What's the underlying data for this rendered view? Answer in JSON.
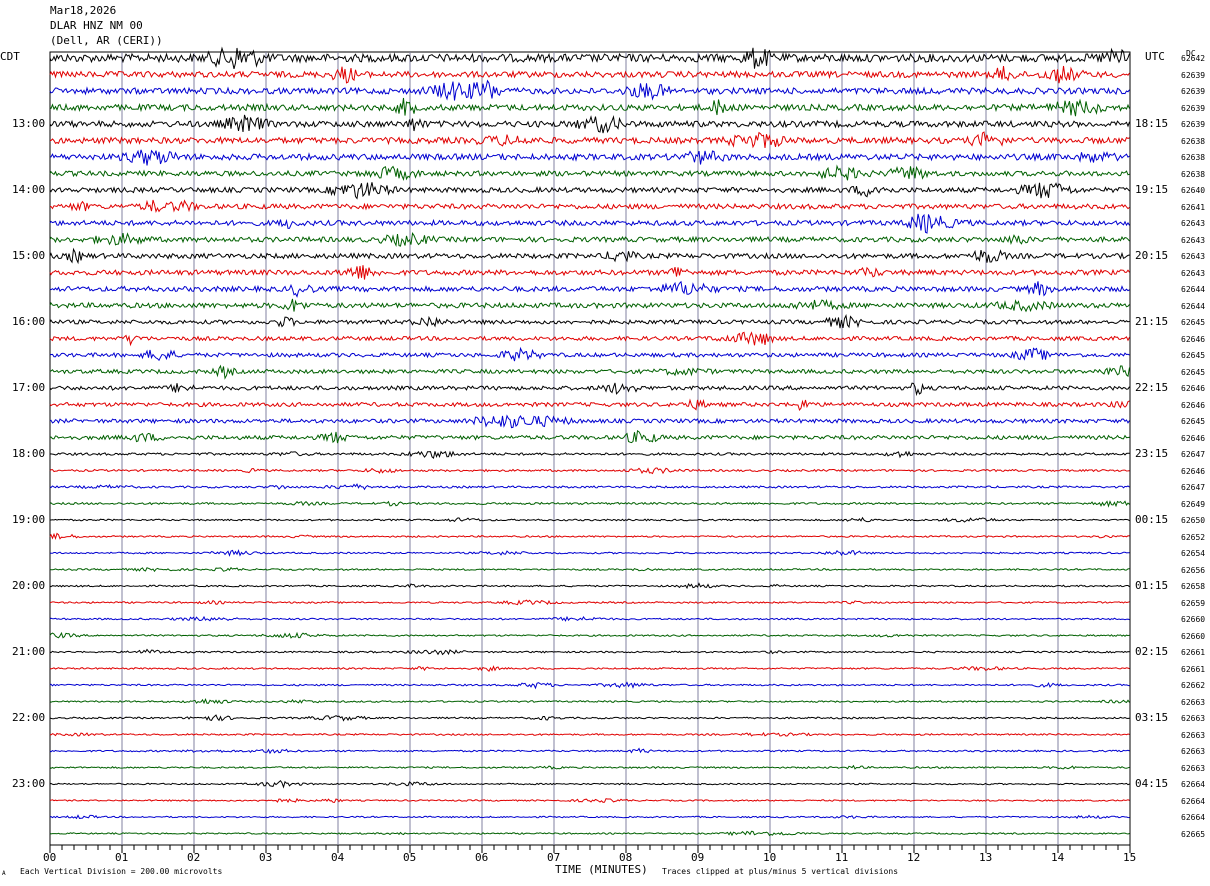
{
  "header": {
    "date": "Mar18,2026",
    "station": "DLAR HNZ NM 00",
    "location": "(Dell, AR (CERI))"
  },
  "left_zone": "CDT",
  "right_zone": "UTC",
  "dc_header": "DC",
  "footer": {
    "scale_note": "Each Vertical Division =  200.00 microvolts",
    "clip_note": "Traces clipped at plus/minus 5 vertical divisions",
    "corner_mark": "A"
  },
  "colors": {
    "black": "#000000",
    "red": "#e00000",
    "blue": "#0000d0",
    "green": "#006000",
    "grid": "#8080a0"
  },
  "chart_data": {
    "type": "line",
    "title": "DLAR HNZ NM 00",
    "xlabel": "TIME (MINUTES)",
    "xlim": [
      0,
      15
    ],
    "x_ticks": [
      "00",
      "01",
      "02",
      "03",
      "04",
      "05",
      "06",
      "07",
      "08",
      "09",
      "10",
      "11",
      "12",
      "13",
      "14",
      "15"
    ],
    "left_hour_labels": [
      "13:00",
      "14:00",
      "15:00",
      "16:00",
      "17:00",
      "18:00",
      "19:00",
      "20:00",
      "21:00",
      "22:00",
      "23:00"
    ],
    "right_hour_labels": [
      "18:15",
      "19:15",
      "20:15",
      "21:15",
      "22:15",
      "23:15",
      "00:15",
      "01:15",
      "02:15",
      "03:15",
      "04:15"
    ],
    "trace_colors": [
      "black",
      "red",
      "blue",
      "green"
    ],
    "dc_offsets": [
      62642,
      62639,
      62639,
      62639,
      62639,
      62638,
      62638,
      62638,
      62640,
      62641,
      62643,
      62643,
      62643,
      62643,
      62644,
      62644,
      62645,
      62646,
      62645,
      62645,
      62646,
      62646,
      62645,
      62646,
      62647,
      62646,
      62647,
      62649,
      62650,
      62652,
      62654,
      62656,
      62658,
      62659,
      62660,
      62660,
      62661,
      62661,
      62662,
      62663,
      62663,
      62663,
      62663,
      62663,
      62664,
      62664,
      62664,
      62665
    ],
    "trace_amplitude": [
      4,
      3,
      3,
      3,
      3,
      3,
      3,
      2.5,
      2.5,
      2.5,
      2.5,
      2.5,
      2.5,
      2.5,
      2.5,
      2.5,
      2,
      2,
      2,
      2,
      2,
      2,
      2,
      2,
      1.2,
      1,
      1,
      1,
      0.8,
      0.8,
      0.8,
      0.8,
      0.8,
      0.8,
      0.8,
      0.8,
      0.8,
      0.8,
      0.8,
      0.8,
      0.8,
      0.8,
      0.8,
      0.8,
      0.7,
      0.7,
      0.7,
      0.7
    ]
  }
}
